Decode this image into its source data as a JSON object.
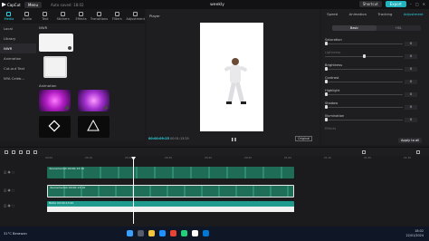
{
  "titlebar": {
    "app": "CapCut",
    "menu": "Menu",
    "autosave": "Auto saved: 18:02",
    "project": "weekly",
    "shortcut": "Shortcut",
    "export": "Export"
  },
  "left_tabs": [
    "Media",
    "Audio",
    "Text",
    "Stickers",
    "Effects",
    "Transitions",
    "Filters",
    "Adjustment"
  ],
  "left_nav": [
    "Local",
    "Library",
    "NWR",
    "Animation",
    "Cut-out Text",
    "NYA Celeb..."
  ],
  "media": {
    "section_nwr": "NWR",
    "section_animation": "Animation"
  },
  "player": {
    "title": "Player",
    "timecode": "00:00:09:25",
    "duration": "00:01:13:25",
    "ratio": "Original"
  },
  "right_panel": {
    "tabs": [
      "Speed",
      "Animation",
      "Tracking",
      "Adjustment"
    ],
    "active_tab": "Adjustment",
    "segments": [
      "Basic",
      "HSL"
    ],
    "sliders": [
      {
        "label": "Saturation",
        "value": "0"
      },
      {
        "label": "Lightness",
        "value": "0"
      },
      {
        "label": "Brightness",
        "value": "0"
      },
      {
        "label": "Contrast",
        "value": "0"
      },
      {
        "label": "Highlight",
        "value": "0"
      },
      {
        "label": "Shadow",
        "value": "0"
      },
      {
        "label": "Illumination",
        "value": "0"
      },
      {
        "label": "Effects",
        "value": ""
      }
    ],
    "apply_all": "Apply to all"
  },
  "timeline": {
    "ruler": [
      "00:00",
      "00:10",
      "00:20",
      "00:30",
      "00:40",
      "00:50",
      "01:00",
      "01:10",
      "01:20",
      "01:30"
    ],
    "clip1": "dancemeirah  00:00:13:19",
    "clip2": "dancemeirah  00:00:13:19",
    "clip3": "BAKA  00:00:13:20"
  },
  "taskbar": {
    "weather": "31°C  Berawan",
    "time": "18:02",
    "date": "22/01/2024"
  },
  "colors": {
    "accent": "#2bd2df",
    "export": "#1fb3bf",
    "clip": "#1e6b56"
  }
}
